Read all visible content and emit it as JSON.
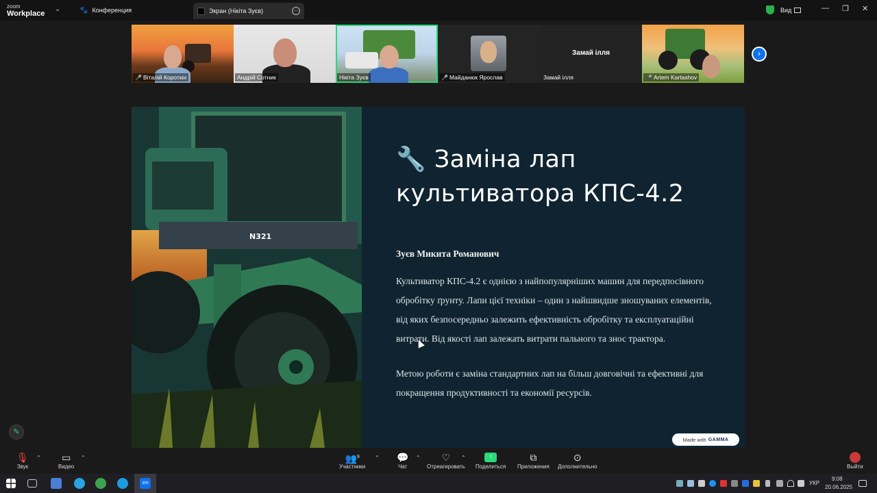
{
  "app": {
    "logo_line1": "zoom",
    "logo_line2": "Workplace",
    "tab_conference": "Конференция",
    "tab_screen": "Экран (Нікіта Зуєв)",
    "view_label": "Вид"
  },
  "participants_strip": [
    {
      "name": "Віталій Короткін",
      "muted": true
    },
    {
      "name": "Андрій Сотник",
      "muted": false
    },
    {
      "name": "Нікіта Зуєв",
      "muted": false,
      "active": true
    },
    {
      "name": "Майданюк Ярослав",
      "muted": true
    },
    {
      "name": "Замай ілля",
      "muted": false,
      "center_label": "Замай ілля"
    },
    {
      "name": "Artem Kartashov",
      "muted": true
    }
  ],
  "slide": {
    "title": "🔧 Заміна лап культиватора КПС-4.2",
    "author": "Зуєв Микита Романович",
    "paragraph1": "Культиватор КПС-4.2 є однією з найпопулярніших машин для передпосівного обробітку ґрунту. Лапи цієї техніки – один з найшвидше зношуваних елементів, від яких безпосередньо залежить ефективність обробітку та експлуатаційні витрати. Від якості лап залежать витрати пального та знос трактора.",
    "paragraph2": "Метою роботи є заміна стандартних лап на більш довговічні та ефективні для покращення продуктивності та економії ресурсів.",
    "badge_prefix": "Made with",
    "badge_brand": "GAMMA",
    "image_text": "N321"
  },
  "toolbar": {
    "audio": "Звук",
    "video": "Видео",
    "participants": "Участники",
    "participants_count": "9",
    "chat": "Чат",
    "react": "Отреагировать",
    "share": "Поделиться",
    "apps": "Приложения",
    "more": "Дополнительно",
    "leave": "Выйти"
  },
  "taskbar": {
    "lang": "УКР",
    "time": "9:08",
    "date": "20.06.2025",
    "active_app_label": "zm"
  },
  "colors": {
    "accent_green": "#2bd97b",
    "zoom_blue": "#0e72ed",
    "slide_bg": "#0f2430",
    "mute_red": "#ff4d4d"
  }
}
